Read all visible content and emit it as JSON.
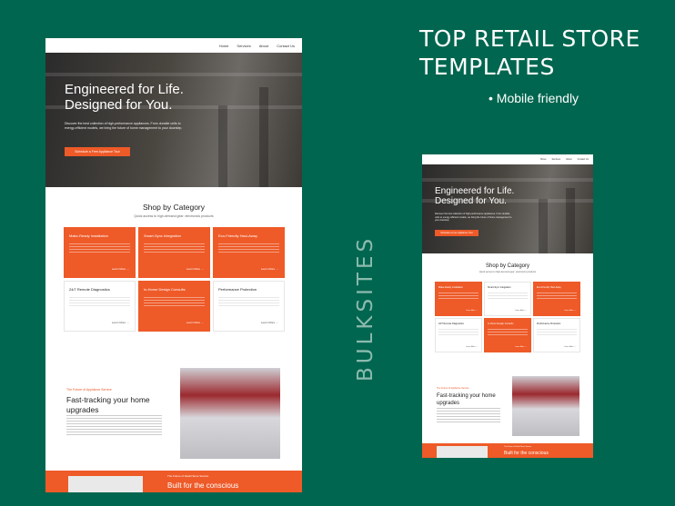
{
  "promo": {
    "title_line1": "TOP RETAIL STORE",
    "title_line2": "TEMPLATES",
    "bullet": "• Mobile friendly",
    "brand": "BULKSITES"
  },
  "site": {
    "nav": [
      "Home",
      "Services",
      "About",
      "Contact Us"
    ],
    "hero": {
      "title_line1": "Engineered for Life.",
      "title_line2": "Designed for You.",
      "text": "Discover the best collection of high-performance appliances. From durable units to energy-efficient models, we bring the future of home management to your doorstep.",
      "cta": "Schedule a Free Appliance Tour"
    },
    "shop": {
      "title": "Shop by Category",
      "subtitle": "Quick access to high-demand gear: electronics products"
    },
    "cards": [
      {
        "title": "Make-Ready Installation",
        "more": "Learn More →"
      },
      {
        "title": "Smart-Sync Integration",
        "more": "Learn More →"
      },
      {
        "title": "Eco-Friendly Haul-Away",
        "more": "Learn More →"
      },
      {
        "title": "24/7 Remote Diagnostics",
        "more": "Learn More →"
      },
      {
        "title": "In-Home Design Consults",
        "more": "Learn More →"
      },
      {
        "title": "Performance Protection",
        "more": "Learn More →"
      }
    ],
    "upgrades": {
      "small": "The Future of Appliance Service",
      "title_line1": "Fast-tracking your home",
      "title_line2": "upgrades"
    },
    "footer": {
      "small": "The Future of Retail Store Service",
      "title": "Built for the conscious"
    }
  },
  "colors": {
    "background": "#00664f",
    "accent": "#ee5a28",
    "white": "#ffffff"
  }
}
